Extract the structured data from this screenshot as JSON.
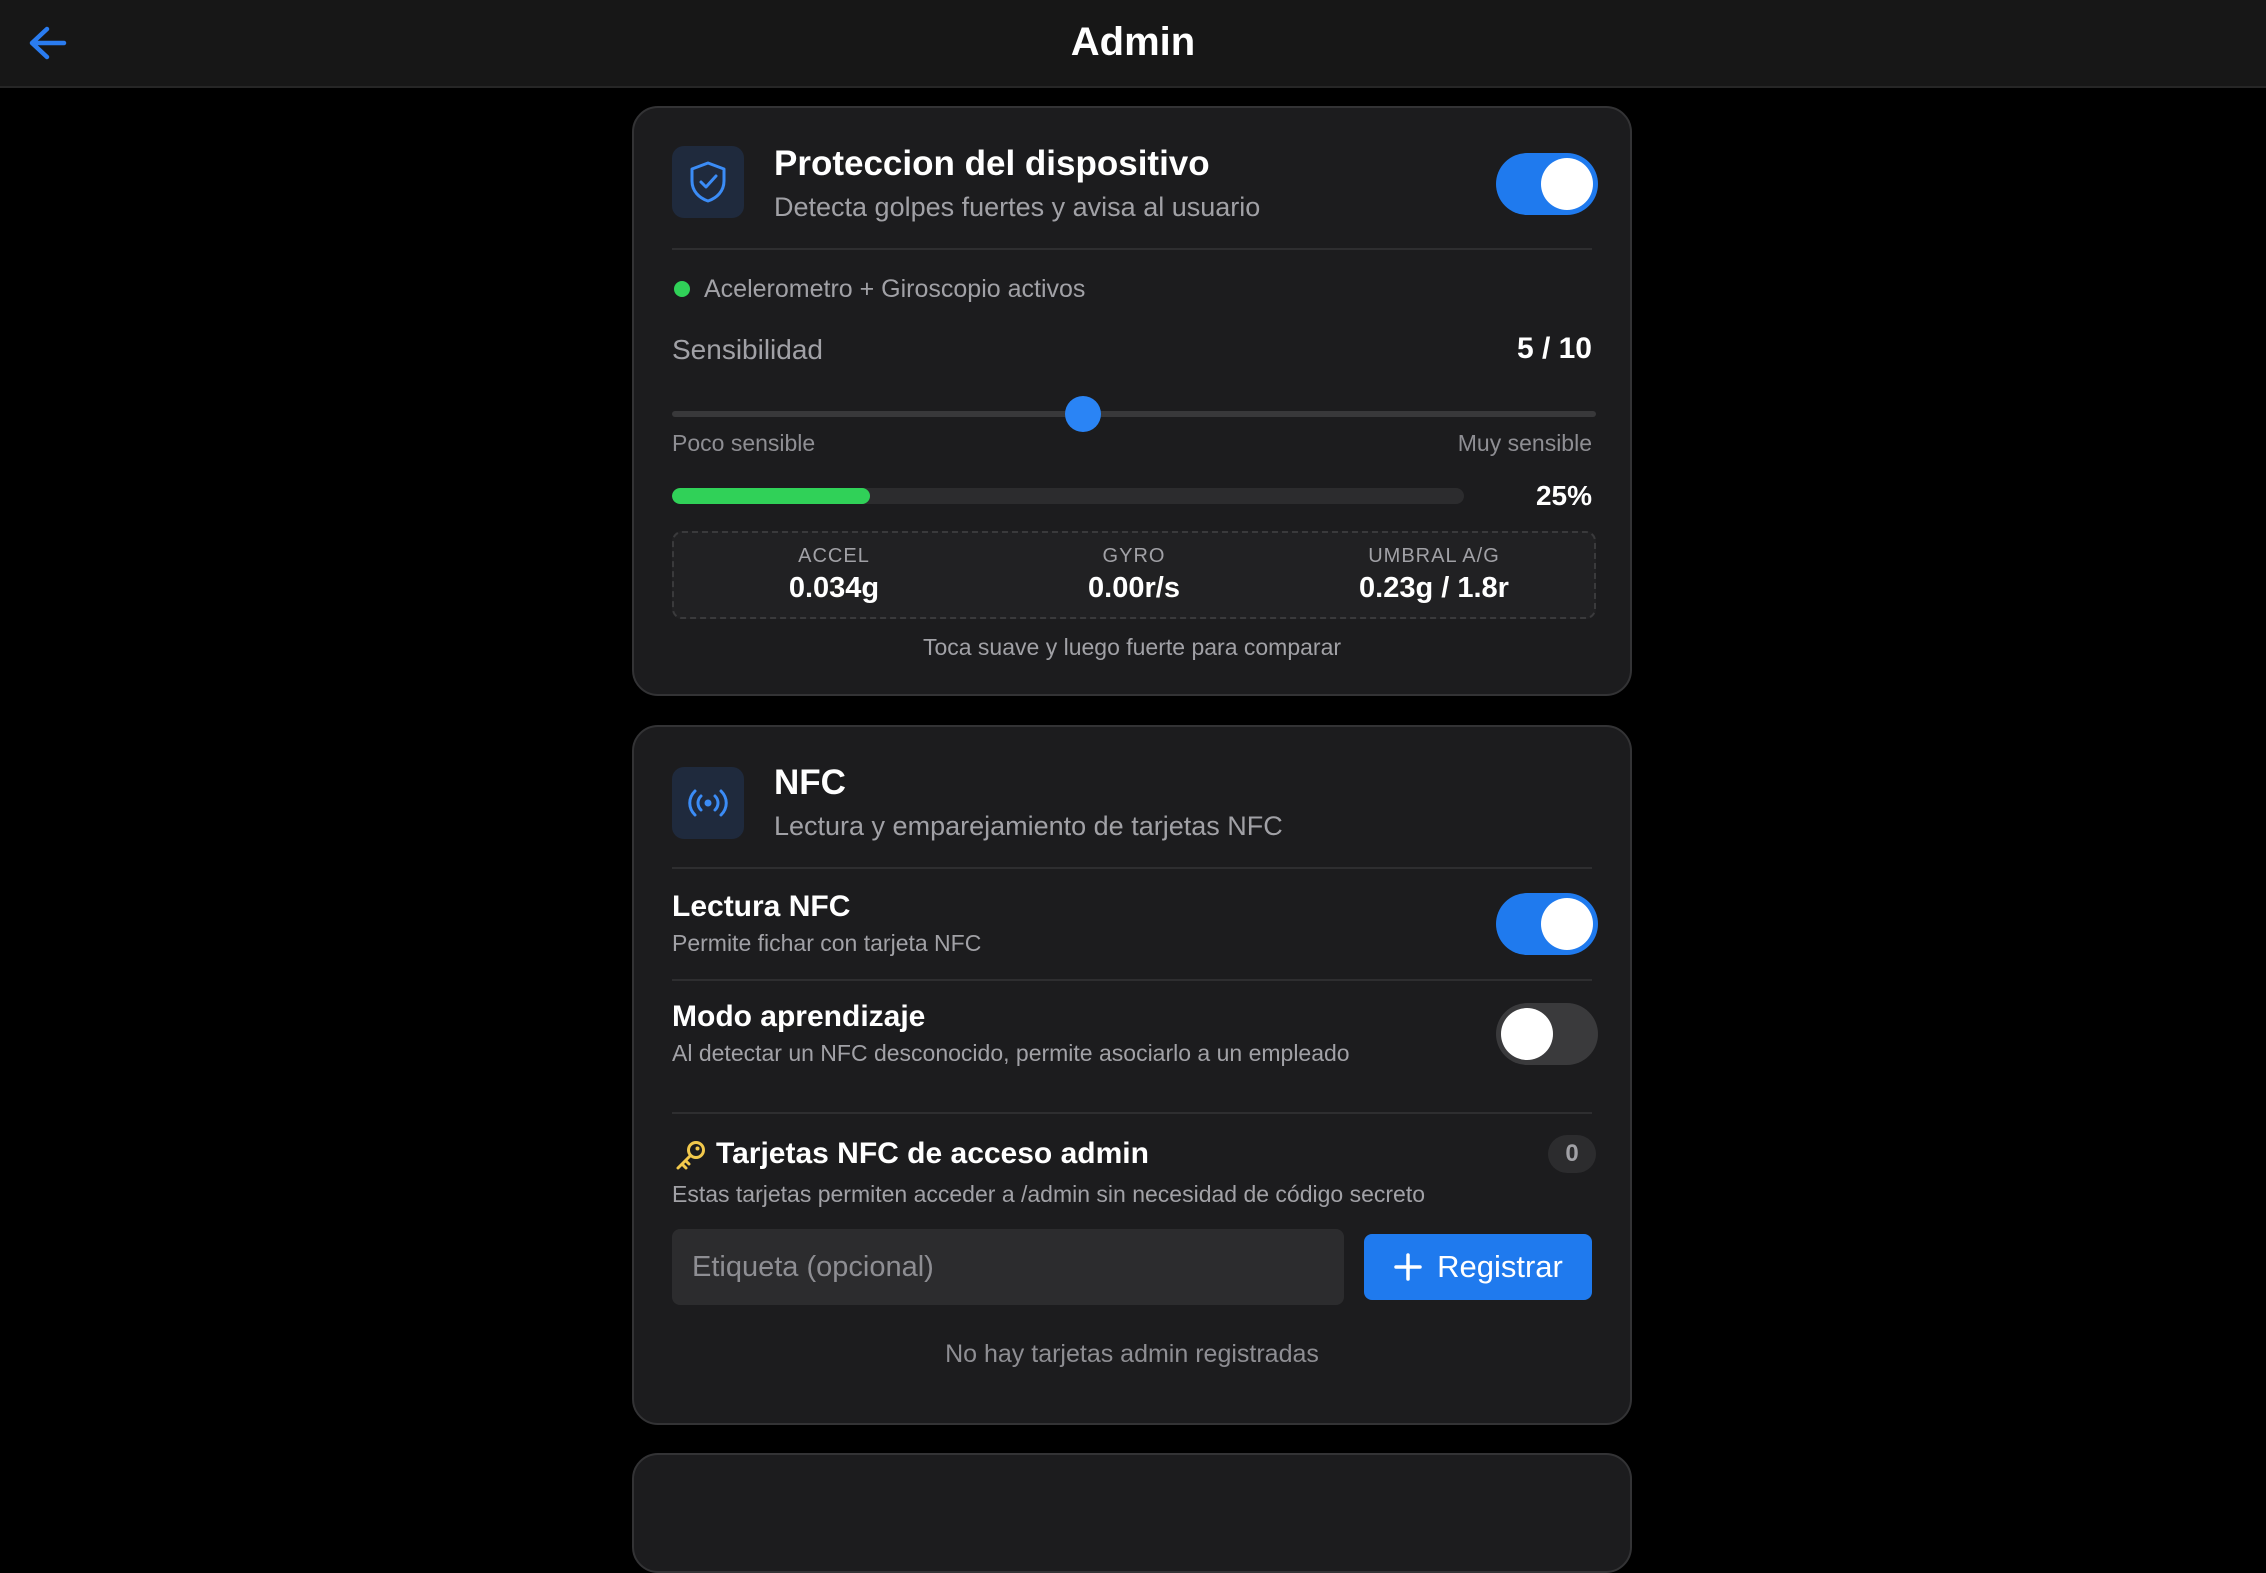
{
  "header": {
    "title": "Admin",
    "back_icon": "arrow-left-icon"
  },
  "colors": {
    "accent": "#1f7aee",
    "success": "#30d158",
    "background": "#000000",
    "card": "#1c1c1e"
  },
  "protection": {
    "icon": "shield-check-icon",
    "title": "Proteccion del dispositivo",
    "subtitle": "Detecta golpes fuertes y avisa al usuario",
    "enabled": true,
    "status_text": "Acelerometro + Giroscopio activos",
    "sensitivity": {
      "label": "Sensibilidad",
      "value_text": "5 / 10",
      "value": 5,
      "max": 10,
      "min_label": "Poco sensible",
      "max_label": "Muy sensible"
    },
    "progress": {
      "value": 0.25,
      "value_text": "25%"
    },
    "metrics": [
      {
        "label": "ACCEL",
        "value": "0.034g"
      },
      {
        "label": "GYRO",
        "value": "0.00r/s"
      },
      {
        "label": "UMBRAL A/G",
        "value": "0.23g / 1.8r"
      }
    ],
    "hint": "Toca suave y luego fuerte para comparar"
  },
  "nfc": {
    "icon": "nfc-waves-icon",
    "title": "NFC",
    "subtitle": "Lectura y emparejamiento de tarjetas NFC",
    "reading": {
      "title": "Lectura NFC",
      "subtitle": "Permite fichar con tarjeta NFC",
      "enabled": true
    },
    "learning": {
      "title": "Modo aprendizaje",
      "subtitle": "Al detectar un NFC desconocido, permite asociarlo a un empleado",
      "enabled": false
    },
    "admin_cards": {
      "icon": "key-icon",
      "title": "Tarjetas NFC de acceso admin",
      "count": "0",
      "subtitle": "Estas tarjetas permiten acceder a /admin sin necesidad de código secreto",
      "input_placeholder": "Etiqueta (opcional)",
      "input_value": "",
      "register_label": "Registrar",
      "empty_text": "No hay tarjetas admin registradas"
    }
  }
}
